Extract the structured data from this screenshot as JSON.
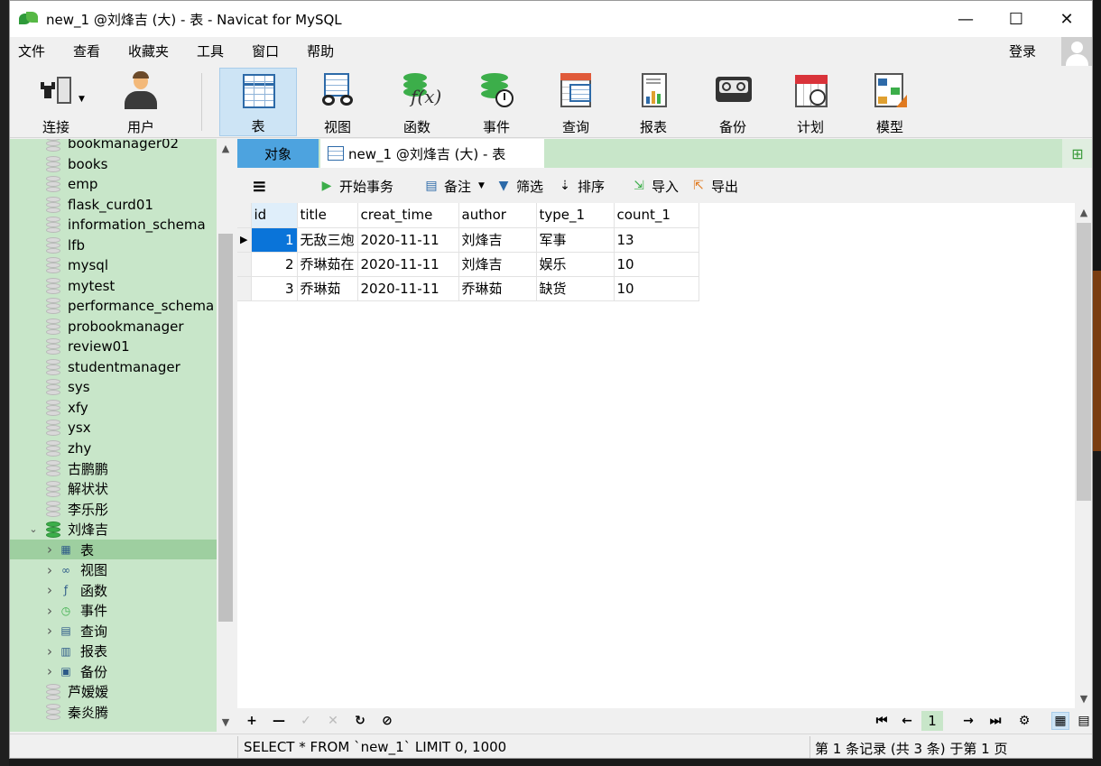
{
  "window": {
    "title": "new_1 @刘烽吉 (大) - 表 - Navicat for MySQL"
  },
  "menu": [
    "文件",
    "查看",
    "收藏夹",
    "工具",
    "窗口",
    "帮助"
  ],
  "login_label": "登录",
  "toolbar": [
    {
      "label": "连接",
      "icon": "connection-icon"
    },
    {
      "label": "用户",
      "icon": "user-icon"
    },
    {
      "label": "表",
      "icon": "table-icon",
      "active": true
    },
    {
      "label": "视图",
      "icon": "view-icon"
    },
    {
      "label": "函数",
      "icon": "function-icon"
    },
    {
      "label": "事件",
      "icon": "event-icon"
    },
    {
      "label": "查询",
      "icon": "query-icon"
    },
    {
      "label": "报表",
      "icon": "report-icon"
    },
    {
      "label": "备份",
      "icon": "backup-icon"
    },
    {
      "label": "计划",
      "icon": "schedule-icon"
    },
    {
      "label": "模型",
      "icon": "model-icon"
    }
  ],
  "sidebar": {
    "databases_top": [
      "bookmanager02",
      "books",
      "emp",
      "flask_curd01",
      "information_schema",
      "lfb",
      "mysql",
      "mytest",
      "performance_schema",
      "probookmanager",
      "review01",
      "studentmanager",
      "sys",
      "xfy",
      "ysx",
      "zhy",
      "古鹏鹏",
      "解状状",
      "李乐彤"
    ],
    "open_database": "刘烽吉",
    "children": [
      {
        "label": "表",
        "icon": "table-icon"
      },
      {
        "label": "视图",
        "icon": "view-icon"
      },
      {
        "label": "函数",
        "icon": "function-icon"
      },
      {
        "label": "事件",
        "icon": "event-icon"
      },
      {
        "label": "查询",
        "icon": "query-icon"
      },
      {
        "label": "报表",
        "icon": "report-icon"
      },
      {
        "label": "备份",
        "icon": "backup-icon"
      }
    ],
    "databases_bottom": [
      "芦嫒嫒",
      "秦炎腾"
    ]
  },
  "tabs": {
    "objects": "对象",
    "table_tab": "new_1 @刘烽吉 (大) - 表"
  },
  "actions": {
    "begin_transaction": "开始事务",
    "note": "备注",
    "filter": "筛选",
    "sort": "排序",
    "import": "导入",
    "export": "导出"
  },
  "grid": {
    "columns": [
      "id",
      "title",
      "creat_time",
      "author",
      "type_1",
      "count_1"
    ],
    "rows": [
      [
        "1",
        "无敌三炮",
        "2020-11-11",
        "刘烽吉",
        "军事",
        "13"
      ],
      [
        "2",
        "乔琳茹在",
        "2020-11-11",
        "刘烽吉",
        "娱乐",
        "10"
      ],
      [
        "3",
        "乔琳茹",
        "2020-11-11",
        "乔琳茹",
        "缺货",
        "10"
      ]
    ]
  },
  "pager": {
    "current_page": "1"
  },
  "status": {
    "sql": "SELECT * FROM `new_1` LIMIT 0, 1000",
    "records": "第 1 条记录 (共 3 条) 于第 1 页"
  }
}
